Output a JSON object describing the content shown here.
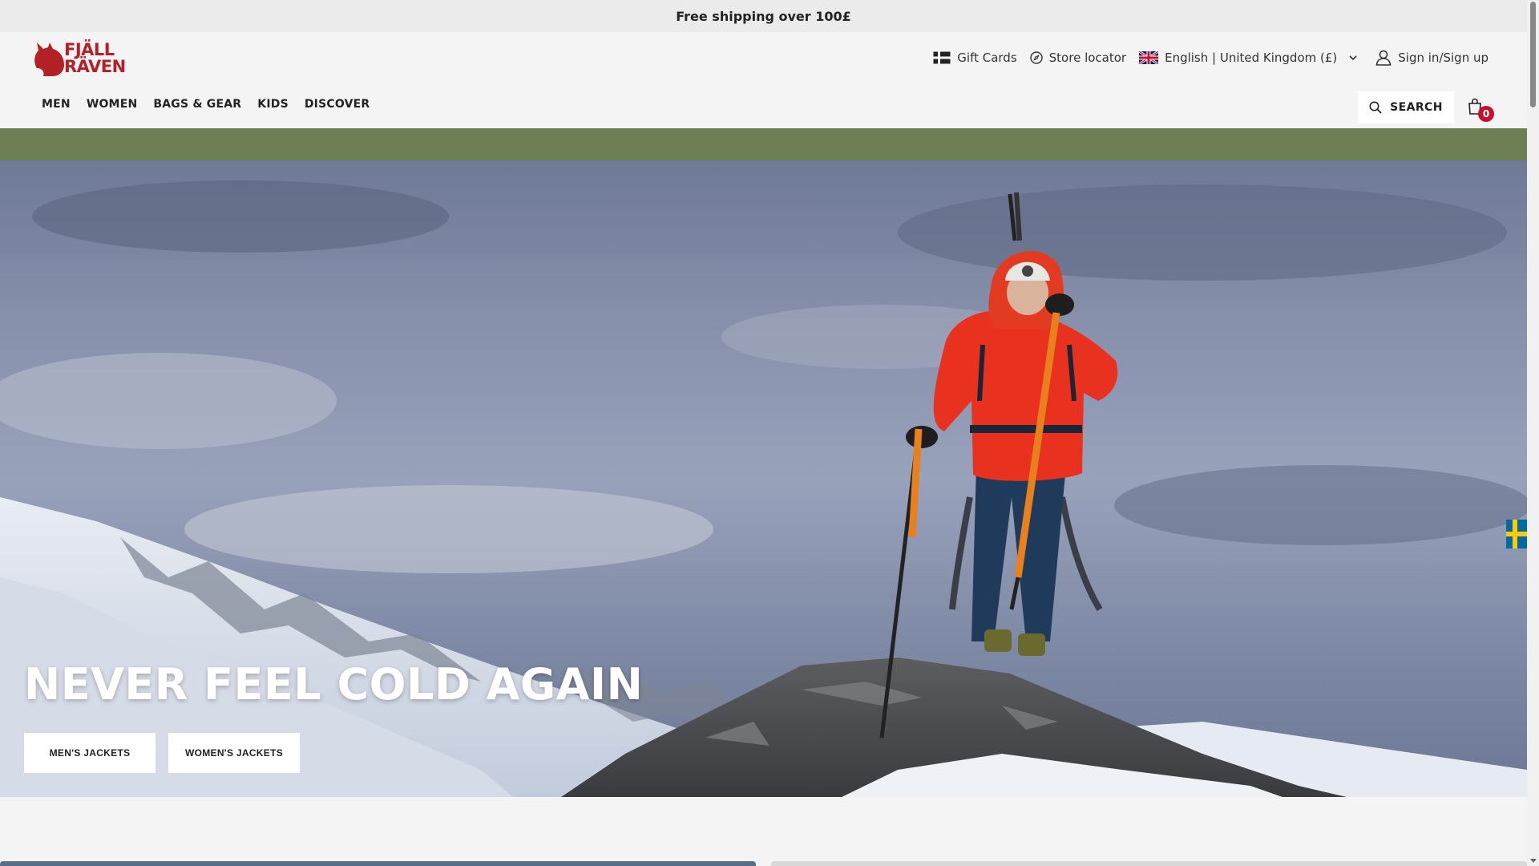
{
  "announcement": "Free shipping over 100£",
  "brand": {
    "line1": "FJÄLL",
    "line2": "RÄVEN",
    "color": "#b32025"
  },
  "utility": {
    "gift_cards": "Gift Cards",
    "store_locator": "Store locator",
    "locale": "English | United Kingdom (£)",
    "sign_in": "Sign in/Sign up"
  },
  "nav": [
    "MEN",
    "WOMEN",
    "BAGS & GEAR",
    "KIDS",
    "DISCOVER"
  ],
  "search_label": "SEARCH",
  "cart_count": "0",
  "hero": {
    "title": "NEVER FEEL COLD AGAIN",
    "buttons": [
      "MEN'S JACKETS",
      "WOMEN'S JACKETS"
    ]
  },
  "colors": {
    "band_green": "#6e7f56",
    "badge_red": "#c8102e",
    "jacket_red": "#e8321f"
  },
  "icons": [
    "fox-logo-icon",
    "gift-card-icon",
    "compass-icon",
    "uk-flag-icon",
    "chevron-down-icon",
    "user-icon",
    "search-icon",
    "cart-icon",
    "sweden-flag-icon"
  ]
}
